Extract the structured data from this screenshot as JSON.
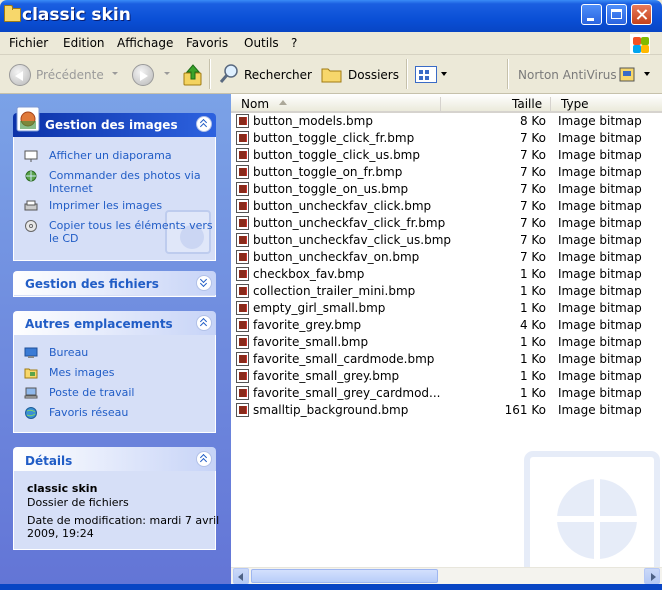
{
  "window": {
    "title": "classic skin"
  },
  "menubar": {
    "items": [
      "Fichier",
      "Edition",
      "Affichage",
      "Favoris",
      "Outils",
      "?"
    ]
  },
  "toolbar": {
    "back_label": "Précédente",
    "search_label": "Rechercher",
    "folders_label": "Dossiers",
    "norton_label": "Norton AntiVirus"
  },
  "sidebar": {
    "image_tasks": {
      "title": "Gestion des images",
      "items": [
        {
          "label": "Afficher un diaporama",
          "icon": "slideshow-icon"
        },
        {
          "label": "Commander des photos via",
          "label2": "Internet",
          "icon": "order-photos-icon"
        },
        {
          "label": "Imprimer les images",
          "icon": "printer-icon"
        },
        {
          "label": "Copier tous les éléments vers",
          "label2": "le CD",
          "icon": "cd-icon"
        }
      ]
    },
    "file_tasks": {
      "title": "Gestion des fichiers"
    },
    "other_places": {
      "title": "Autres emplacements",
      "items": [
        {
          "label": "Bureau",
          "icon": "desktop-icon"
        },
        {
          "label": "Mes images",
          "icon": "my-pictures-icon"
        },
        {
          "label": "Poste de travail",
          "icon": "my-computer-icon"
        },
        {
          "label": "Favoris réseau",
          "icon": "network-icon"
        }
      ]
    },
    "details": {
      "title": "Détails",
      "name": "classic skin",
      "kind": "Dossier de fichiers",
      "modified_line1": "Date de modification: mardi 7 avril",
      "modified_line2": "2009, 19:24"
    }
  },
  "filelist": {
    "columns": {
      "name": "Nom",
      "size": "Taille",
      "type": "Type"
    },
    "rows": [
      {
        "name": "button_models.bmp",
        "size": "8 Ko",
        "type": "Image bitmap"
      },
      {
        "name": "button_toggle_click_fr.bmp",
        "size": "7 Ko",
        "type": "Image bitmap"
      },
      {
        "name": "button_toggle_click_us.bmp",
        "size": "7 Ko",
        "type": "Image bitmap"
      },
      {
        "name": "button_toggle_on_fr.bmp",
        "size": "7 Ko",
        "type": "Image bitmap"
      },
      {
        "name": "button_toggle_on_us.bmp",
        "size": "7 Ko",
        "type": "Image bitmap"
      },
      {
        "name": "button_uncheckfav_click.bmp",
        "size": "7 Ko",
        "type": "Image bitmap"
      },
      {
        "name": "button_uncheckfav_click_fr.bmp",
        "size": "7 Ko",
        "type": "Image bitmap"
      },
      {
        "name": "button_uncheckfav_click_us.bmp",
        "size": "7 Ko",
        "type": "Image bitmap"
      },
      {
        "name": "button_uncheckfav_on.bmp",
        "size": "7 Ko",
        "type": "Image bitmap"
      },
      {
        "name": "checkbox_fav.bmp",
        "size": "1 Ko",
        "type": "Image bitmap"
      },
      {
        "name": "collection_trailer_mini.bmp",
        "size": "1 Ko",
        "type": "Image bitmap"
      },
      {
        "name": "empty_girl_small.bmp",
        "size": "1 Ko",
        "type": "Image bitmap"
      },
      {
        "name": "favorite_grey.bmp",
        "size": "4 Ko",
        "type": "Image bitmap"
      },
      {
        "name": "favorite_small.bmp",
        "size": "1 Ko",
        "type": "Image bitmap"
      },
      {
        "name": "favorite_small_cardmode.bmp",
        "size": "1 Ko",
        "type": "Image bitmap"
      },
      {
        "name": "favorite_small_grey.bmp",
        "size": "1 Ko",
        "type": "Image bitmap"
      },
      {
        "name": "favorite_small_grey_cardmod...",
        "size": "1 Ko",
        "type": "Image bitmap"
      },
      {
        "name": "smalltip_background.bmp",
        "size": "161 Ko",
        "type": "Image bitmap"
      }
    ]
  },
  "colors": {
    "titlebar": "#0a4fd6",
    "taskpane": "#6f8fe0",
    "link": "#215dc6"
  }
}
